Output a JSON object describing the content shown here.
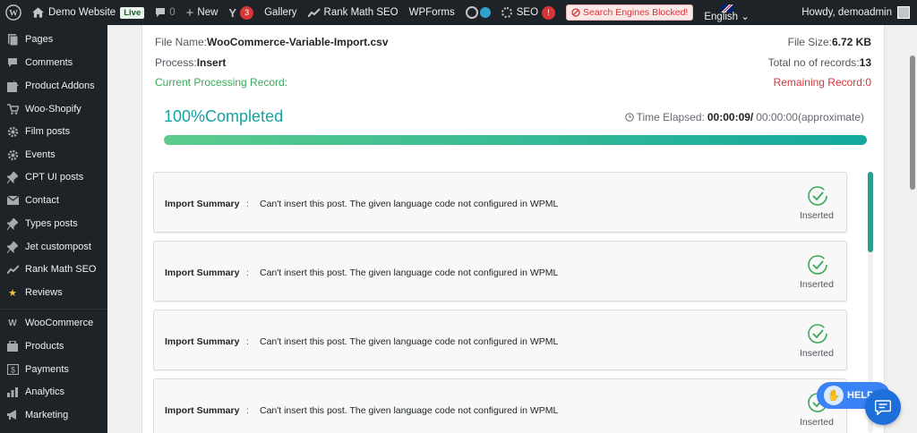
{
  "adminbar": {
    "site_name": "Demo Website",
    "live_badge": "Live",
    "comments_count": "0",
    "new_label": "New",
    "yoast_count": "3",
    "gallery": "Gallery",
    "rankmath": "Rank Math SEO",
    "wpforms": "WPForms",
    "seo": "SEO",
    "seo_badge": "!",
    "blocked": "Search Engines Blocked!",
    "language": "English",
    "howdy": "Howdy, demoadmin"
  },
  "sidebar": {
    "items": [
      {
        "label": "Pages",
        "icon": "pages-icon"
      },
      {
        "label": "Comments",
        "icon": "comments-icon"
      },
      {
        "label": "Product Addons",
        "icon": "addons-icon"
      },
      {
        "label": "Woo-Shopify",
        "icon": "cart-icon"
      },
      {
        "label": "Film posts",
        "icon": "gear-icon"
      },
      {
        "label": "Events",
        "icon": "gear-icon"
      },
      {
        "label": "CPT UI posts",
        "icon": "pin-icon"
      },
      {
        "label": "Contact",
        "icon": "mail-icon"
      },
      {
        "label": "Types posts",
        "icon": "pin-icon"
      },
      {
        "label": "Jet custompost",
        "icon": "pin-icon"
      },
      {
        "label": "Rank Math SEO",
        "icon": "chart-icon"
      },
      {
        "label": "Reviews",
        "icon": "star-icon"
      },
      {
        "label": "WooCommerce",
        "icon": "woo-icon"
      },
      {
        "label": "Products",
        "icon": "products-icon"
      },
      {
        "label": "Payments",
        "icon": "payments-icon"
      },
      {
        "label": "Analytics",
        "icon": "analytics-icon"
      },
      {
        "label": "Marketing",
        "icon": "megaphone-icon"
      }
    ]
  },
  "import": {
    "file_name_label": "File Name:",
    "file_name": "WooCommerce-Variable-Import.csv",
    "file_size_label": "File Size:",
    "file_size": "6.72 KB",
    "process_label": "Process:",
    "process": "Insert",
    "total_label": "Total no of records:",
    "total": "13",
    "current_label": "Current Processing Record:",
    "remaining_label": "Remaining Record:",
    "remaining": "0",
    "completed_text": "100%Completed",
    "progress": 1.0,
    "elapsed_label": "Time Elapsed:",
    "elapsed": "00:00:09/",
    "approx": "00:00:00(approximate)"
  },
  "summary": {
    "rows": [
      {
        "label": "Import Summary",
        "sep": ":",
        "message": "Can't insert this post. The given language code not configured in WPML",
        "status": "Inserted"
      },
      {
        "label": "Import Summary",
        "sep": ":",
        "message": "Can't insert this post. The given language code not configured in WPML",
        "status": "Inserted"
      },
      {
        "label": "Import Summary",
        "sep": ":",
        "message": "Can't insert this post. The given language code not configured in WPML",
        "status": "Inserted"
      },
      {
        "label": "Import Summary",
        "sep": ":",
        "message": "Can't insert this post. The given language code not configured in WPML",
        "status": "Inserted"
      }
    ]
  },
  "help": {
    "label": "HELP"
  },
  "colors": {
    "accent": "#14a3a3",
    "success": "#3aa859",
    "error": "#d63638",
    "adminbar": "#1d2327"
  }
}
